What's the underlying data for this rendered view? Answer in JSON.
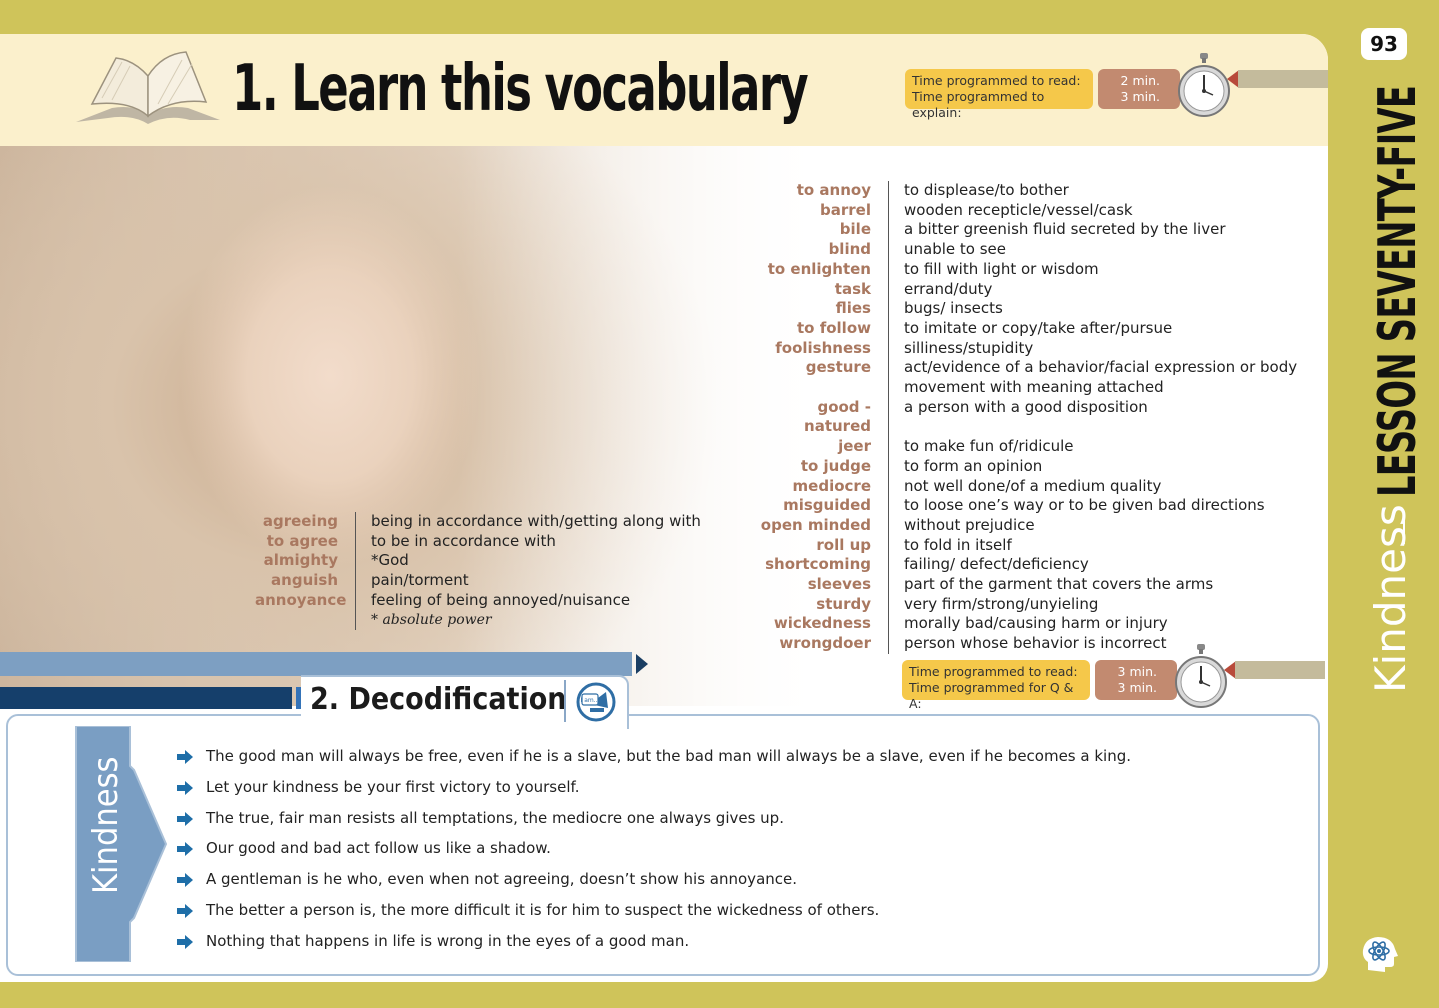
{
  "page": {
    "number": "93",
    "lesson": "LESSON SEVENTY-FIVE",
    "topic": "Kindness"
  },
  "section1": {
    "title": "1. Learn this vocabulary"
  },
  "timer1": {
    "label_read": "Time programmed to read:",
    "label_explain": "Time programmed to explain:",
    "value_read": "2 min.",
    "value_explain": "3 min."
  },
  "vocab_right": [
    {
      "term": "to annoy",
      "def": "to displease/to bother"
    },
    {
      "term": "barrel",
      "def": "wooden recepticle/vessel/cask"
    },
    {
      "term": "bile",
      "def": "a bitter greenish fluid secreted by the liver"
    },
    {
      "term": "blind",
      "def": "unable to see"
    },
    {
      "term": "to enlighten",
      "def": "to fill with light or wisdom"
    },
    {
      "term": "task",
      "def": "errand/duty"
    },
    {
      "term": "flies",
      "def": "bugs/ insects"
    },
    {
      "term": "to follow",
      "def": "to imitate or copy/take after/pursue"
    },
    {
      "term": "foolishness",
      "def": "silliness/stupidity"
    },
    {
      "term": "gesture",
      "def": "act/evidence of a behavior/facial expression or body"
    },
    {
      "term": "",
      "def": "movement with meaning attached"
    },
    {
      "term": "good - natured",
      "def": "a person with a good disposition"
    },
    {
      "term": "jeer",
      "def": "to make fun of/ridicule"
    },
    {
      "term": "to judge",
      "def": "to form an opinion"
    },
    {
      "term": "mediocre",
      "def": "not well done/of a medium quality"
    },
    {
      "term": "misguided",
      "def": "to loose one’s way or to be given bad directions"
    },
    {
      "term": "open minded",
      "def": "without prejudice"
    },
    {
      "term": "roll up",
      "def": "to fold in itself"
    },
    {
      "term": "shortcoming",
      "def": "failing/ defect/deficiency"
    },
    {
      "term": "sleeves",
      "def": "part of the garment that covers the arms"
    },
    {
      "term": "sturdy",
      "def": "very firm/strong/unyieling"
    },
    {
      "term": "wickedness",
      "def": "morally bad/causing harm or injury"
    },
    {
      "term": "wrongdoer",
      "def": "person whose behavior is incorrect"
    }
  ],
  "vocab_left": [
    {
      "term": "agreeing",
      "def": "being in accordance with/getting along with"
    },
    {
      "term": "to agree",
      "def": "to be in accordance with"
    },
    {
      "term": "almighty",
      "def": "*God"
    },
    {
      "term": "anguish",
      "def": "pain/torment"
    },
    {
      "term": "annoyance",
      "def": "feeling of being annoyed/nuisance"
    }
  ],
  "footnote": "* absolute power",
  "timer2": {
    "label_read": "Time programmed to read:",
    "label_qa": "Time programmed for Q & A:",
    "value_read": "3 min.",
    "value_qa": "3 min."
  },
  "section2": {
    "title": "2. Decodification",
    "icon_label": "I am..."
  },
  "side_label": "Kindness",
  "quotes": [
    "The good man will always be free, even if he is a slave, but the bad man will always be a slave, even if he becomes a king.",
    "Let your kindness be your first victory to yourself.",
    "The true, fair man resists all  temptations, the mediocre one always gives up.",
    "Our good and bad act follow us like a shadow.",
    "A gentleman is he who, even when not agreeing, doesn’t show his annoyance.",
    "The better a person is, the more difficult it is for him to suspect the wickedness of others.",
    "Nothing that happens in life is wrong in the eyes of a good man."
  ],
  "colors": {
    "frame": "#cfc45a",
    "term": "#a97860",
    "timer_label": "#f5c84a",
    "timer_value": "#c28a70",
    "navy": "#153f6b",
    "steel": "#7d9fc2"
  }
}
